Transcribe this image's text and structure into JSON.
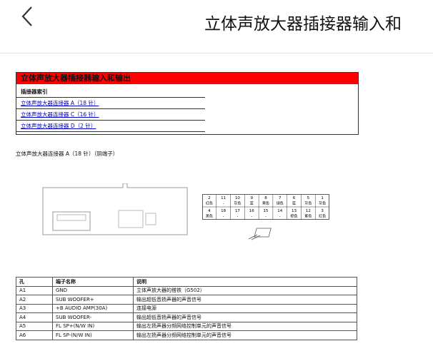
{
  "header": {
    "back_icon": "chevron-left-icon",
    "title": "立体声放大器插接器输入和"
  },
  "doc": {
    "index": {
      "heading": "立体声放大器插接器输入和输出",
      "subheading": "插接器索引",
      "links": [
        "立体声放大器连接器 A（18 针）",
        "立体声放大器连接器 C（16 针）",
        "立体声放大器连接器 D（2 针）"
      ]
    },
    "caption": "立体声放大器连接器 A（18 针）（阴端子）",
    "pins_top": [
      {
        "num": "2",
        "label": "红色"
      },
      {
        "num": "11",
        "label": "-"
      },
      {
        "num": "10",
        "label": "灰色"
      },
      {
        "num": "9",
        "label": "蓝"
      },
      {
        "num": "8",
        "label": "黄色"
      },
      {
        "num": "7",
        "label": "绿色"
      },
      {
        "num": "6",
        "label": "蓝"
      },
      {
        "num": "5",
        "label": "灰色"
      },
      {
        "num": "1",
        "label": "灰色"
      }
    ],
    "pins_bottom": [
      {
        "num": "4",
        "label": "黑色"
      },
      {
        "num": "18",
        "label": "-"
      },
      {
        "num": "17",
        "label": "-"
      },
      {
        "num": "16",
        "label": "-"
      },
      {
        "num": "15",
        "label": "-"
      },
      {
        "num": "14",
        "label": "-"
      },
      {
        "num": "13",
        "label": "棕色"
      },
      {
        "num": "12",
        "label": "紫色"
      },
      {
        "num": "3",
        "label": "红色"
      }
    ],
    "table": {
      "headers": [
        "孔",
        "端子名称",
        "说明"
      ],
      "rows": [
        [
          "A1",
          "GND",
          "立体声放大器的搭铁（G502）"
        ],
        [
          "A2",
          "SUB WOOFER+",
          "输出超低音扬声器的声音信号"
        ],
        [
          "A3",
          "+B AUDIO AMP(30A)",
          "连接电源"
        ],
        [
          "A4",
          "SUB WOOFER-",
          "输出超低音扬声器的声音信号"
        ],
        [
          "A5",
          "FL SP+(N/W IN)",
          "输出左扬声器分频网络控制单元的声音信号"
        ],
        [
          "A6",
          "FL SP-(N/W IN)",
          "输出左扬声器分频网络控制单元的声音信号"
        ]
      ]
    }
  }
}
